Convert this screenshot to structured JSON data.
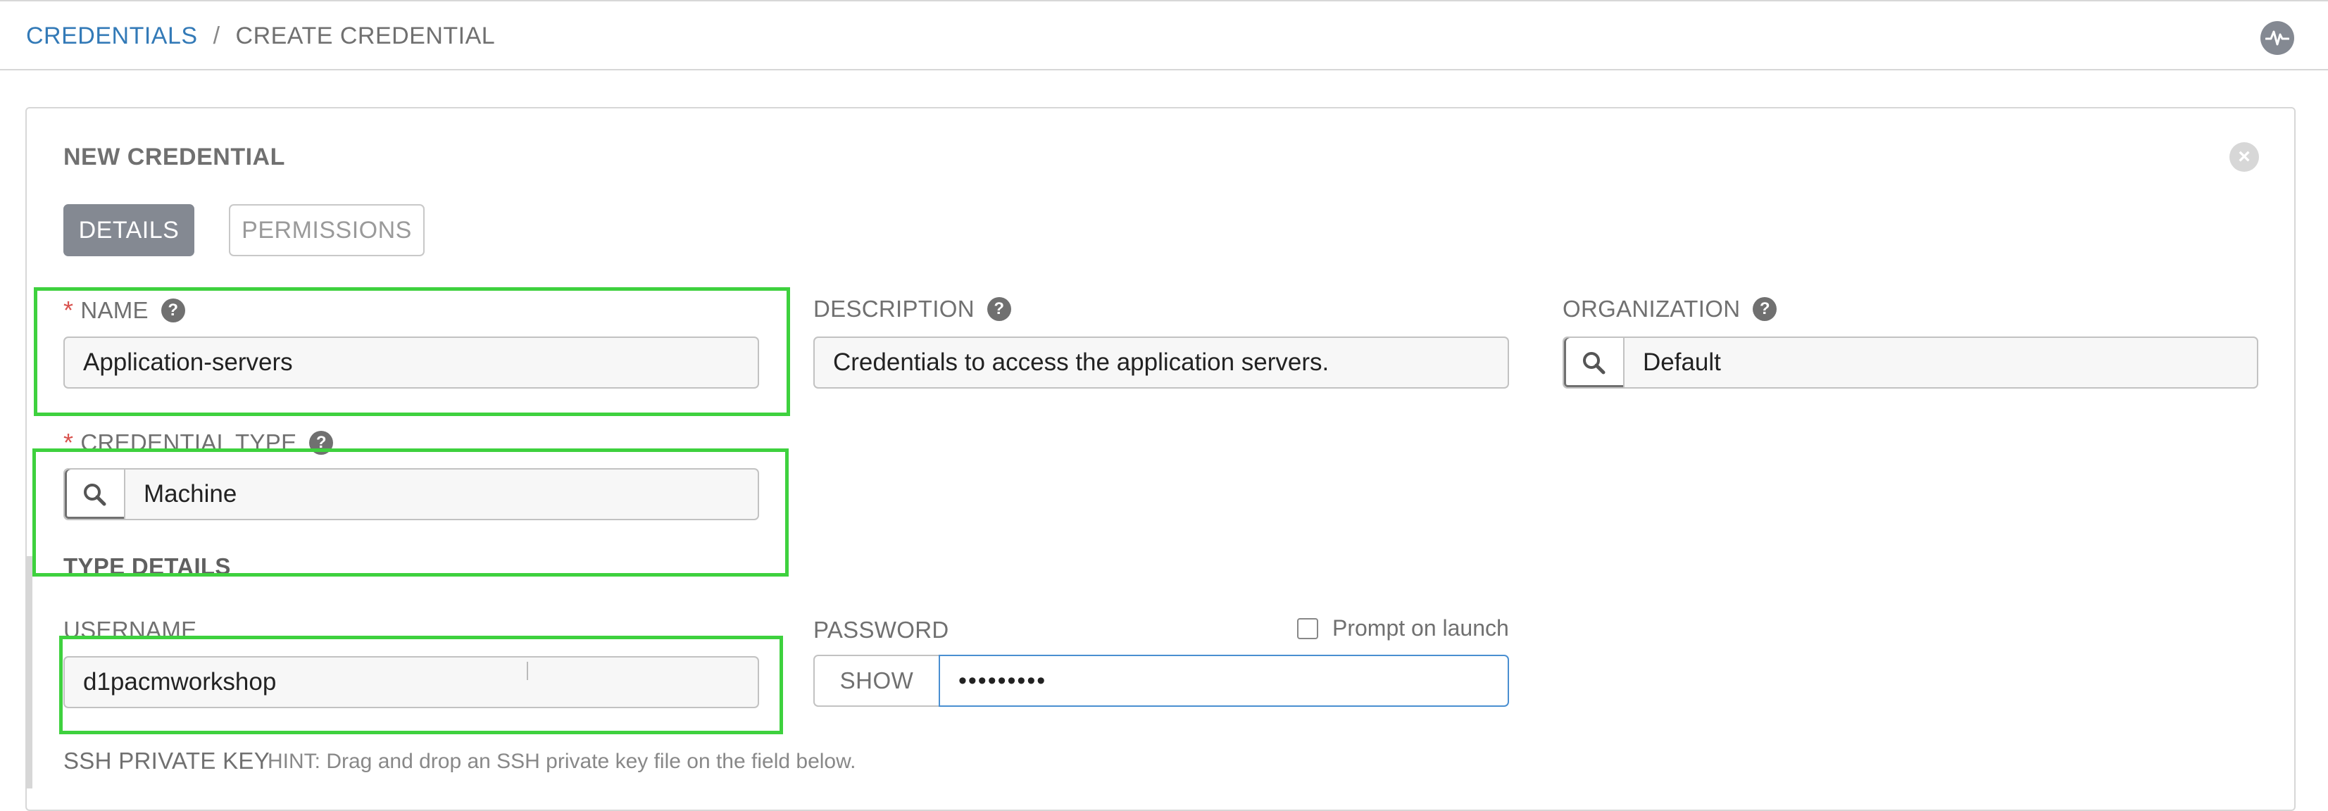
{
  "breadcrumb": {
    "parent": "CREDENTIALS",
    "separator": "/",
    "current": "CREATE CREDENTIAL"
  },
  "topbar": {
    "activity_icon": "activity-stream-icon"
  },
  "panel": {
    "title": "NEW CREDENTIAL",
    "close_icon": "close-icon",
    "tabs": [
      {
        "label": "DETAILS",
        "active": true
      },
      {
        "label": "PERMISSIONS",
        "active": false
      }
    ]
  },
  "form": {
    "name": {
      "label": "NAME",
      "required": "*",
      "value": "Application-servers"
    },
    "description": {
      "label": "DESCRIPTION",
      "value": "Credentials to access the application servers."
    },
    "organization": {
      "label": "ORGANIZATION",
      "value": "Default"
    },
    "credential_type": {
      "label": "CREDENTIAL TYPE",
      "required": "*",
      "value": "Machine"
    },
    "type_details_title": "TYPE DETAILS",
    "username": {
      "label": "USERNAME",
      "value": "d1pacmworkshop"
    },
    "password": {
      "label": "PASSWORD",
      "show_label": "SHOW",
      "value": "•••••••••",
      "prompt_label": "Prompt on launch"
    },
    "ssh_key": {
      "label": "SSH PRIVATE KEY",
      "hint": "HINT: Drag and drop an SSH private key file on the field below."
    }
  },
  "colors": {
    "link": "#337ab7",
    "highlight": "#3ed13e",
    "required": "#d9534f",
    "active_tab": "#848992",
    "focus_border": "#4a8fd1"
  }
}
